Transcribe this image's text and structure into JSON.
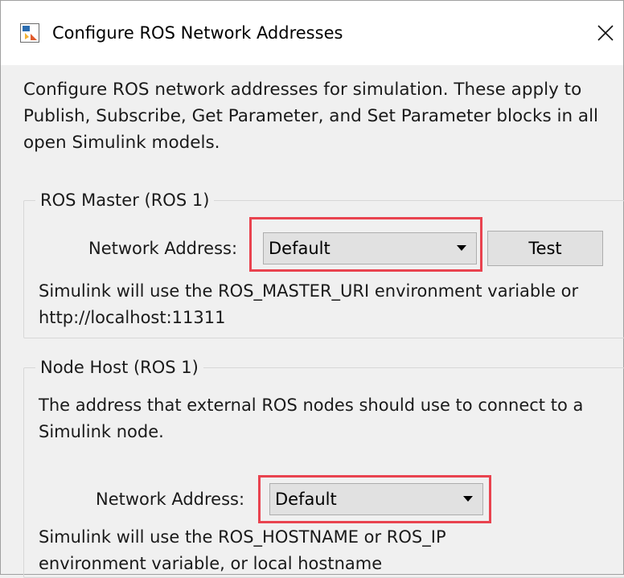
{
  "window": {
    "title": "Configure ROS Network Addresses",
    "icon": "simulink-app-icon",
    "close_icon": "close-icon"
  },
  "intro": "Configure ROS network addresses for simulation. These apply to Publish, Subscribe, Get Parameter, and Set Parameter blocks in all open Simulink models.",
  "ros_master": {
    "legend": "ROS Master (ROS 1)",
    "network_address_label": "Network Address:",
    "network_address_value": "Default",
    "test_button": "Test",
    "description": "Simulink will use the ROS_MASTER_URI environment variable or http://localhost:11311"
  },
  "node_host": {
    "legend": "Node Host (ROS 1)",
    "info": "The address that external ROS nodes should use to connect to a Simulink node.",
    "network_address_label": "Network Address:",
    "network_address_value": "Default",
    "description": "Simulink will use the ROS_HOSTNAME or ROS_IP environment variable, or local hostname"
  },
  "colors": {
    "highlight": "#e9434f",
    "window_bg": "#f0f0f0",
    "titlebar_bg": "#ffffff"
  }
}
